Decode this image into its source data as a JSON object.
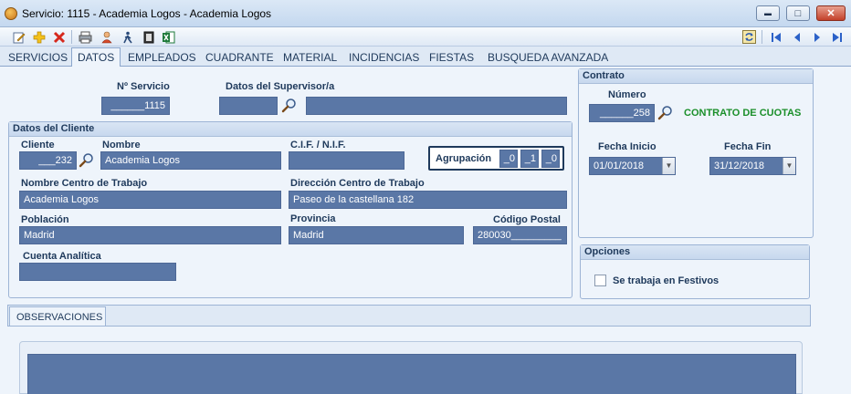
{
  "window": {
    "title": "Servicio: 1115 - Academia Logos - Academia Logos",
    "minimize": "▬",
    "maximize": "□",
    "close": "✕"
  },
  "tabs": [
    "SERVICIOS",
    "DATOS",
    "EMPLEADOS",
    "CUADRANTE",
    "MATERIAL",
    "INCIDENCIAS",
    "FIESTAS",
    "BUSQUEDA AVANZADA"
  ],
  "servicio": {
    "label": "Nº Servicio",
    "value": "______1115"
  },
  "supervisor": {
    "label": "Datos del Supervisor/a",
    "code": "",
    "name": ""
  },
  "cliente_panel": {
    "title": "Datos del Cliente",
    "cliente_label": "Cliente",
    "cliente_value": "___232",
    "nombre_label": "Nombre",
    "nombre_value": "Academia Logos",
    "cif_label": "C.I.F. / N.I.F.",
    "cif_value": "",
    "agrupacion_label": "Agrupación",
    "agrupacion_values": [
      "_0",
      "_1",
      "_0"
    ],
    "centro_label": "Nombre Centro de Trabajo",
    "centro_value": "Academia Logos",
    "direccion_label": "Dirección Centro de Trabajo",
    "direccion_value": "Paseo de la castellana 182",
    "poblacion_label": "Población",
    "poblacion_value": "Madrid",
    "provincia_label": "Provincia",
    "provincia_value": "Madrid",
    "cp_label": "Código Postal",
    "cp_value": "280030_________",
    "cuenta_label": "Cuenta Analítica",
    "cuenta_value": ""
  },
  "contrato": {
    "title": "Contrato",
    "numero_label": "Número",
    "numero_value": "______258",
    "tipo": "CONTRATO DE CUOTAS",
    "inicio_label": "Fecha Inicio",
    "inicio_value": "01/01/2018",
    "fin_label": "Fecha Fin",
    "fin_value": "31/12/2018"
  },
  "opciones": {
    "title": "Opciones",
    "festivos_label": "Se trabaja en Festivos"
  },
  "observaciones": {
    "tab_label": "OBSERVACIONES"
  },
  "colors": {
    "field_bg": "#5a77a6",
    "panel_bg": "#eef4fb",
    "accent_green": "#1b8f2a"
  }
}
